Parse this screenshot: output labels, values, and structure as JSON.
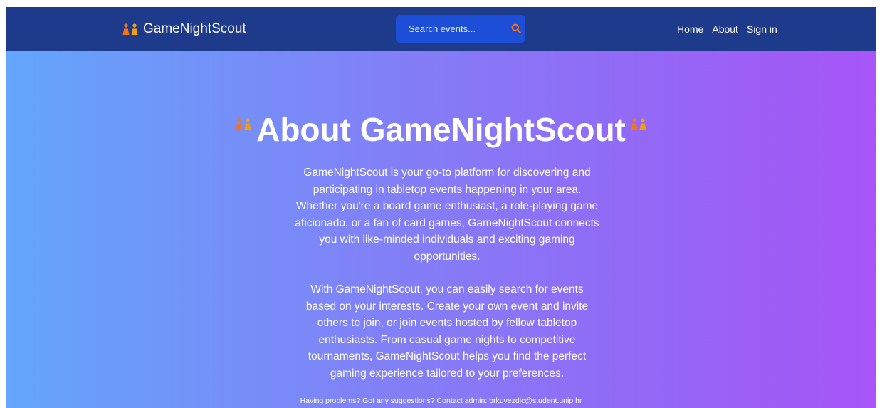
{
  "navbar": {
    "brand_icon": "meeple-pair-icon",
    "brand_name": "GameNightScout",
    "search": {
      "placeholder": "Search events...",
      "icon": "search-icon",
      "icon_color": "#f97316"
    },
    "links": [
      {
        "label": "Home"
      },
      {
        "label": "About"
      },
      {
        "label": "Sign in"
      }
    ],
    "background_color": "#1e3a8a"
  },
  "hero": {
    "title": "About GameNightScout",
    "title_icon": "meeple-pair-icon",
    "paragraphs": [
      "GameNightScout is your go-to platform for discovering and participating in tabletop events happening in your area. Whether you're a board game enthusiast, a role-playing game aficionado, or a fan of card games, GameNightScout connects you with like-minded individuals and exciting gaming opportunities.",
      "With GameNightScout, you can easily search for events based on your interests. Create your own event and invite others to join, or join events hosted by fellow tabletop enthusiasts. From casual game nights to competitive tournaments, GameNightScout helps you find the perfect gaming experience tailored to your preferences."
    ],
    "gradient_start": "#63a6fb",
    "gradient_end": "#a855f7"
  },
  "footer": {
    "text": "Having problems? Got any suggestions? Contact admin: ",
    "email": "brkuvezdic@student.unip.hr"
  }
}
